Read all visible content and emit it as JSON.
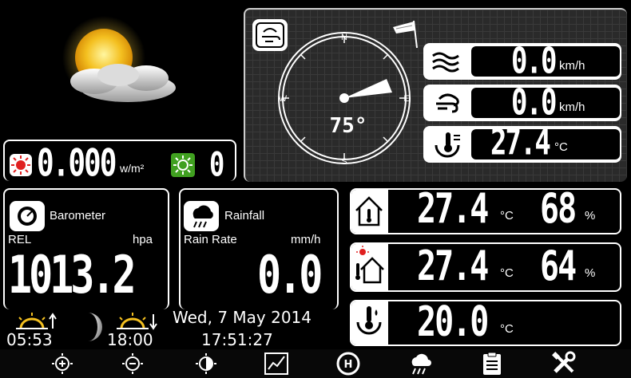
{
  "solar": {
    "value": "0.000",
    "unit": "w/m²",
    "uvi": "0"
  },
  "wind": {
    "compass": {
      "n": "N",
      "s": "S",
      "e": "E",
      "w": "W",
      "direction": "75°",
      "direction_deg": 75
    },
    "speed": {
      "value": "0.0",
      "unit": "km/h"
    },
    "gust": {
      "value": "0.0",
      "unit": "km/h"
    },
    "chill": {
      "value": "27.4",
      "unit": "°C"
    }
  },
  "barometer": {
    "title": "Barometer",
    "mode": "REL",
    "unit": "hpa",
    "value": "1013.2"
  },
  "rainfall": {
    "title": "Rainfall",
    "mode": "Rain Rate",
    "unit": "mm/h",
    "value": "0.0"
  },
  "indoor": {
    "temp": "27.4",
    "temp_unit": "°C",
    "humidity": "68",
    "hum_unit": "%"
  },
  "outdoor": {
    "temp": "27.4",
    "temp_unit": "°C",
    "humidity": "64",
    "hum_unit": "%"
  },
  "dewpoint": {
    "temp": "20.0",
    "temp_unit": "°C"
  },
  "sun": {
    "sunrise": "05:53",
    "sunset": "18:00"
  },
  "clock": {
    "date": "Wed, 7 May 2014",
    "time": "17:51:27"
  },
  "nav": {
    "icons": [
      "zoom-in-icon",
      "zoom-out-icon",
      "brightness-icon",
      "graph-icon",
      "barometer-icon",
      "rain-icon",
      "notes-icon",
      "settings-icon"
    ]
  },
  "colors": {
    "sun": "#f4c020",
    "alarm_red": "#e02020",
    "uv_green": "#40a020"
  }
}
